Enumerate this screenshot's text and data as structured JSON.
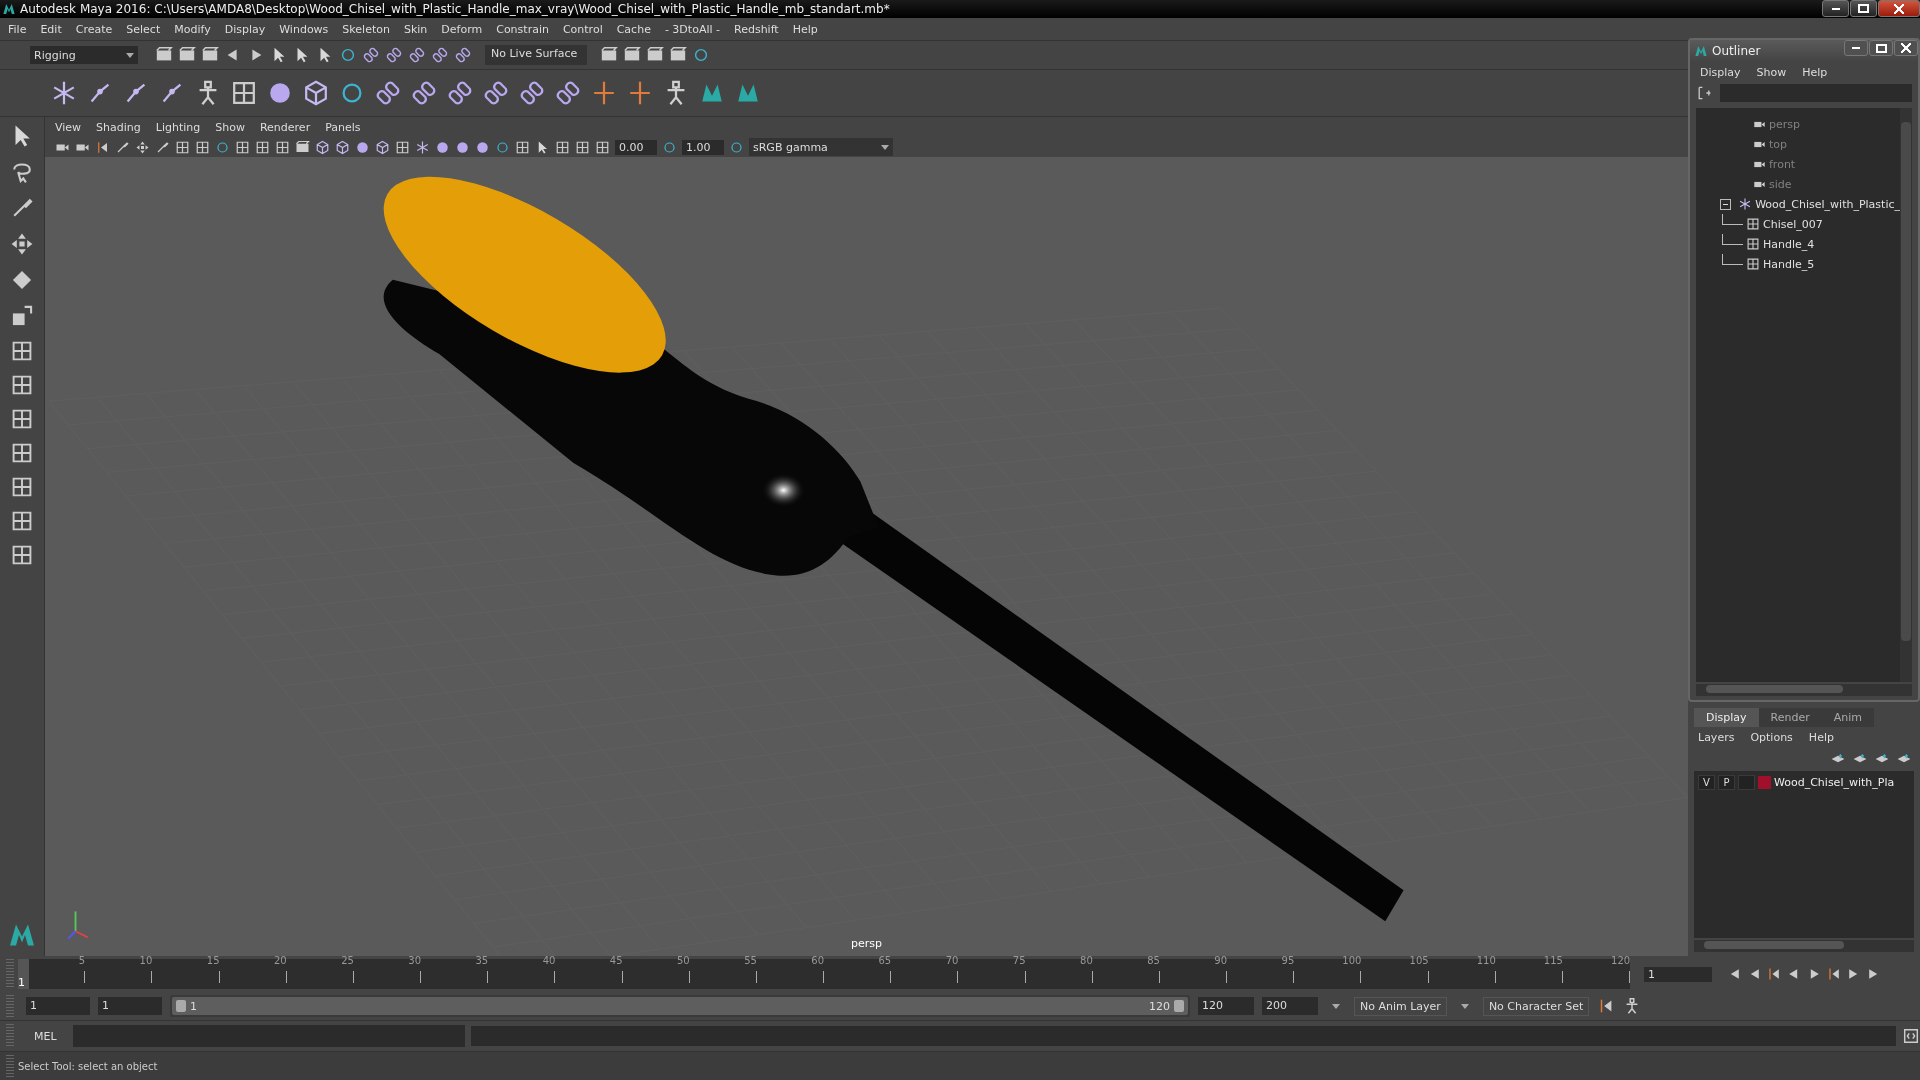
{
  "window": {
    "title": "Autodesk Maya 2016: C:\\Users\\AMDA8\\Desktop\\Wood_Chisel_with_Plastic_Handle_max_vray\\Wood_Chisel_with_Plastic_Handle_mb_standart.mb*"
  },
  "menu_bar": [
    "File",
    "Edit",
    "Create",
    "Select",
    "Modify",
    "Display",
    "Windows",
    "Skeleton",
    "Skin",
    "Deform",
    "Constrain",
    "Control",
    "Cache",
    "- 3DtoAll -",
    "Redshift",
    "Help"
  ],
  "status_line": {
    "menu_set": "Rigging",
    "live_surface": "No Live Surface"
  },
  "viewport": {
    "menus": [
      "View",
      "Shading",
      "Lighting",
      "Show",
      "Renderer",
      "Panels"
    ],
    "near_value": "0.00",
    "far_value": "1.00",
    "color_space": "sRGB gamma",
    "camera_label": "persp"
  },
  "outliner": {
    "title": "Outliner",
    "menus": [
      "Display",
      "Show",
      "Help"
    ],
    "items": [
      {
        "label": "persp",
        "kind": "camera",
        "dimmed": true
      },
      {
        "label": "top",
        "kind": "camera",
        "dimmed": true
      },
      {
        "label": "front",
        "kind": "camera",
        "dimmed": true
      },
      {
        "label": "side",
        "kind": "camera",
        "dimmed": true
      },
      {
        "label": "Wood_Chisel_with_Plastic_",
        "kind": "group",
        "dimmed": false,
        "expanded": true,
        "children": [
          {
            "label": "Chisel_007",
            "kind": "mesh",
            "dimmed": false
          },
          {
            "label": "Handle_4",
            "kind": "mesh",
            "dimmed": false
          },
          {
            "label": "Handle_5",
            "kind": "mesh",
            "dimmed": false
          }
        ]
      }
    ]
  },
  "layer_editor": {
    "tabs": [
      {
        "label": "Display",
        "selected": true
      },
      {
        "label": "Render",
        "selected": false
      },
      {
        "label": "Anim",
        "selected": false
      }
    ],
    "menus": [
      "Layers",
      "Options",
      "Help"
    ],
    "layers": [
      {
        "visibility": "V",
        "playback": "P",
        "color": "#a0102a",
        "name": "Wood_Chisel_with_Pla"
      }
    ]
  },
  "time_slider": {
    "current_frame": "1",
    "level": 0,
    "ticks": [
      "5",
      "10",
      "15",
      "20",
      "25",
      "30",
      "35",
      "40",
      "45",
      "50",
      "55",
      "60",
      "65",
      "70",
      "75",
      "80",
      "85",
      "90",
      "95",
      "100",
      "105",
      "110",
      "115",
      "120"
    ],
    "frame_field": "1"
  },
  "range_slider": {
    "level": 1,
    "start": "1",
    "playback_start": "1",
    "range_start": "1",
    "range_end": "120",
    "playback_end": "120",
    "end": "200",
    "anim_layer": "No Anim Layer",
    "character_set": "No Character Set"
  },
  "command_line": {
    "label": "MEL"
  },
  "help_line": "Select Tool: select an object"
}
